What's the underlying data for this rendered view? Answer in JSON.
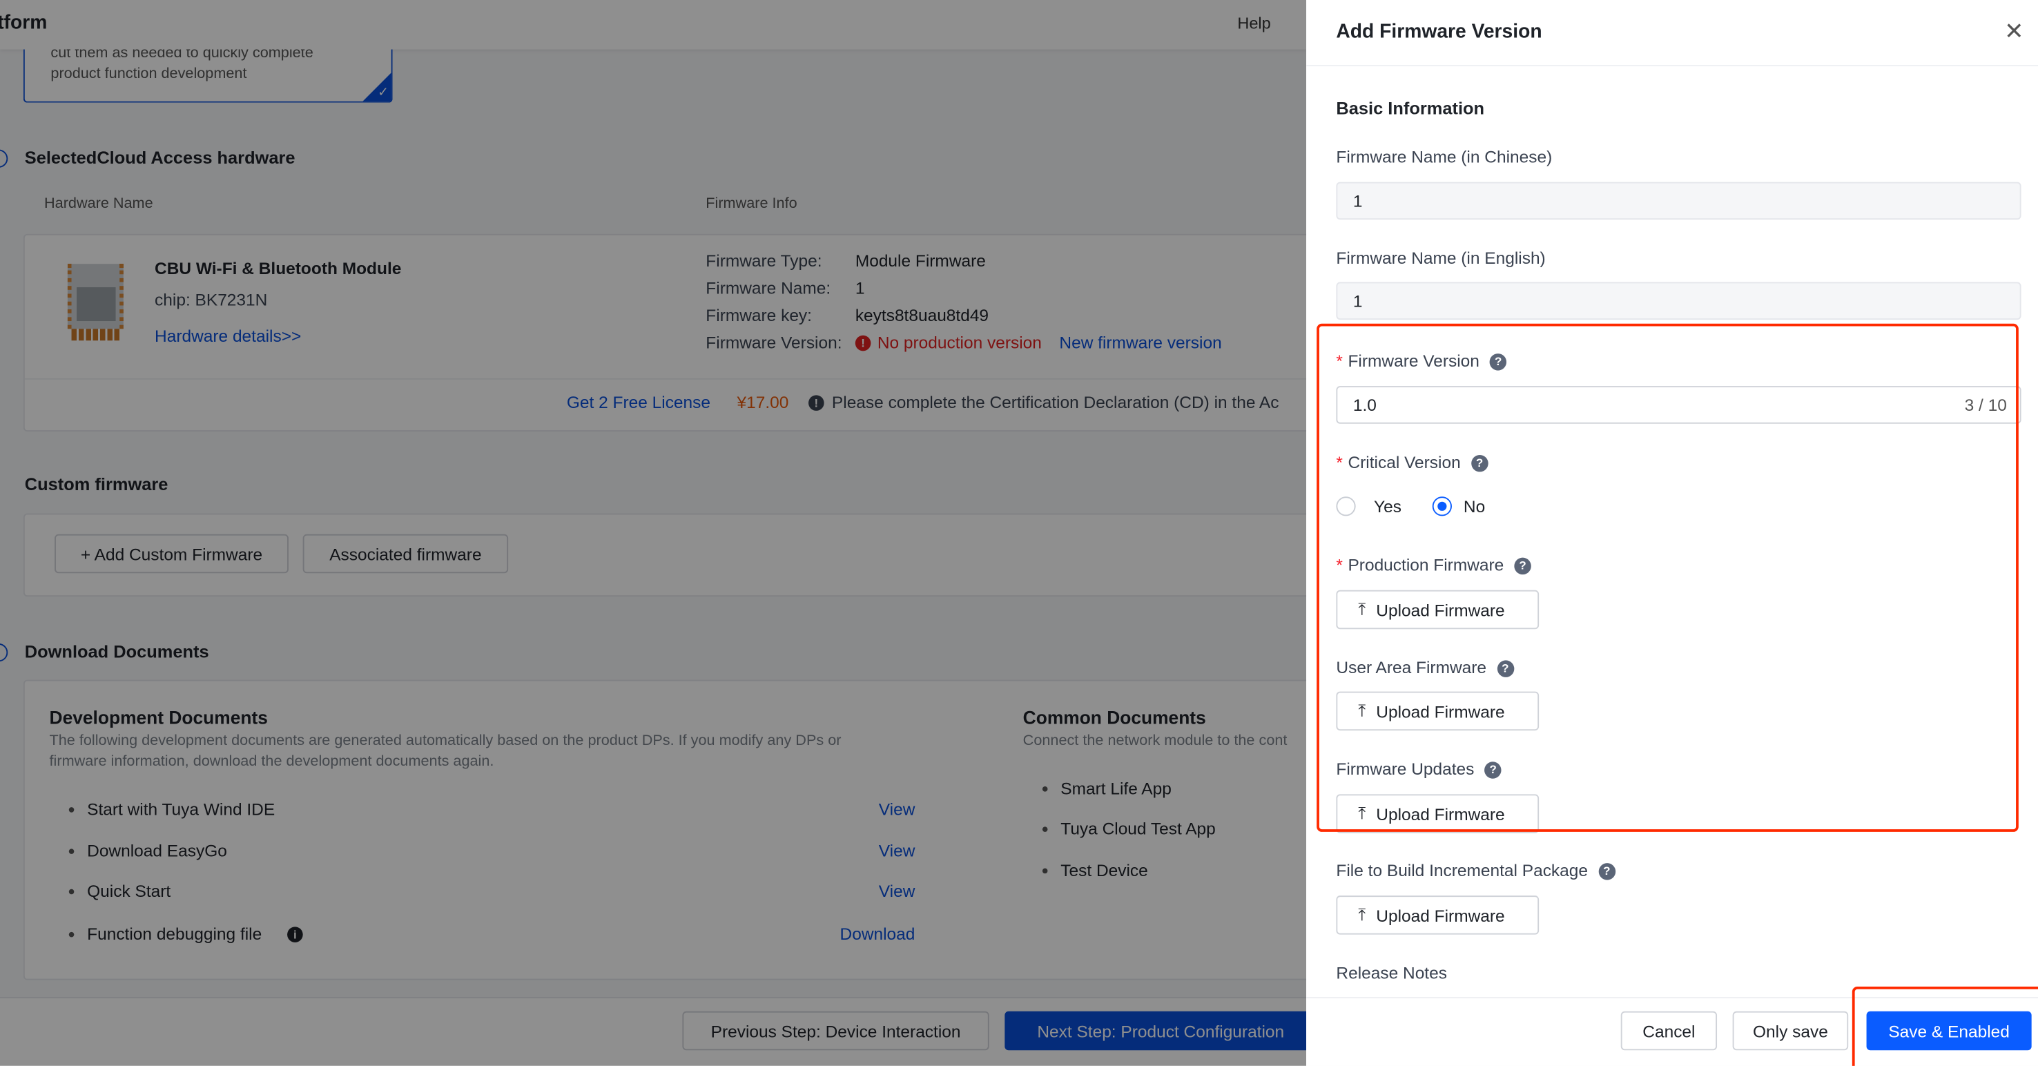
{
  "header": {
    "title_fragment": "tform",
    "help": "Help"
  },
  "selected_card": {
    "line1": "cut them as needed to quickly complete",
    "line2": "product function development"
  },
  "hardware_section": {
    "title": "SelectedCloud Access hardware",
    "col_hardware": "Hardware Name",
    "col_firmware": "Firmware Info",
    "module_name": "CBU Wi-Fi & Bluetooth Module",
    "chip": "chip: BK7231N",
    "details_link": "Hardware details>>",
    "info": [
      {
        "label": "Firmware Type:",
        "value": "Module Firmware"
      },
      {
        "label": "Firmware Name:",
        "value": "1"
      },
      {
        "label": "Firmware key:",
        "value": "keyts8t8uau8td49"
      },
      {
        "label": "Firmware Version:",
        "value": "No production version",
        "link": "New firmware version"
      }
    ],
    "license_link": "Get 2 Free License",
    "price": "¥17.00",
    "cd_notice": "Please complete the Certification Declaration (CD) in the Ac"
  },
  "custom_firmware": {
    "title": "Custom firmware",
    "add_button": "+ Add Custom Firmware",
    "associated_button": "Associated firmware"
  },
  "documents": {
    "title": "Download Documents",
    "dev_title": "Development Documents",
    "dev_desc1": "The following development documents are generated automatically based on the product DPs. If you modify any DPs or",
    "dev_desc2": "firmware information, download the development documents again.",
    "dev_items": [
      {
        "label": "Start with Tuya Wind IDE",
        "action": "View"
      },
      {
        "label": "Download EasyGo",
        "action": "View"
      },
      {
        "label": "Quick Start",
        "action": "View"
      },
      {
        "label": "Function debugging file",
        "action": "Download"
      }
    ],
    "common_title": "Common Documents",
    "common_desc": "Connect the network module to the cont",
    "common_items": [
      "Smart Life App",
      "Tuya Cloud Test App",
      "Test Device"
    ]
  },
  "footer": {
    "prev": "Previous Step: Device Interaction",
    "next": "Next Step: Product Configuration"
  },
  "drawer": {
    "title": "Add Firmware Version",
    "section": "Basic Information",
    "name_cn_label": "Firmware Name (in Chinese)",
    "name_cn_value": "1",
    "name_en_label": "Firmware Name (in English)",
    "name_en_value": "1",
    "version_label": "Firmware Version",
    "version_value": "1.0",
    "version_count": "3 / 10",
    "critical_label": "Critical Version",
    "yes": "Yes",
    "no": "No",
    "critical_selected": "No",
    "production_label": "Production Firmware",
    "user_area_label": "User Area Firmware",
    "updates_label": "Firmware Updates",
    "incremental_label": "File to Build Incremental Package",
    "upload": "Upload Firmware",
    "release_notes": "Release Notes",
    "cancel": "Cancel",
    "only_save": "Only save",
    "save_enabled": "Save & Enabled"
  },
  "colors": {
    "primary": "#0a5cff",
    "highlight": "#ff2a00",
    "error": "#e02020",
    "price": "#e8590c"
  }
}
